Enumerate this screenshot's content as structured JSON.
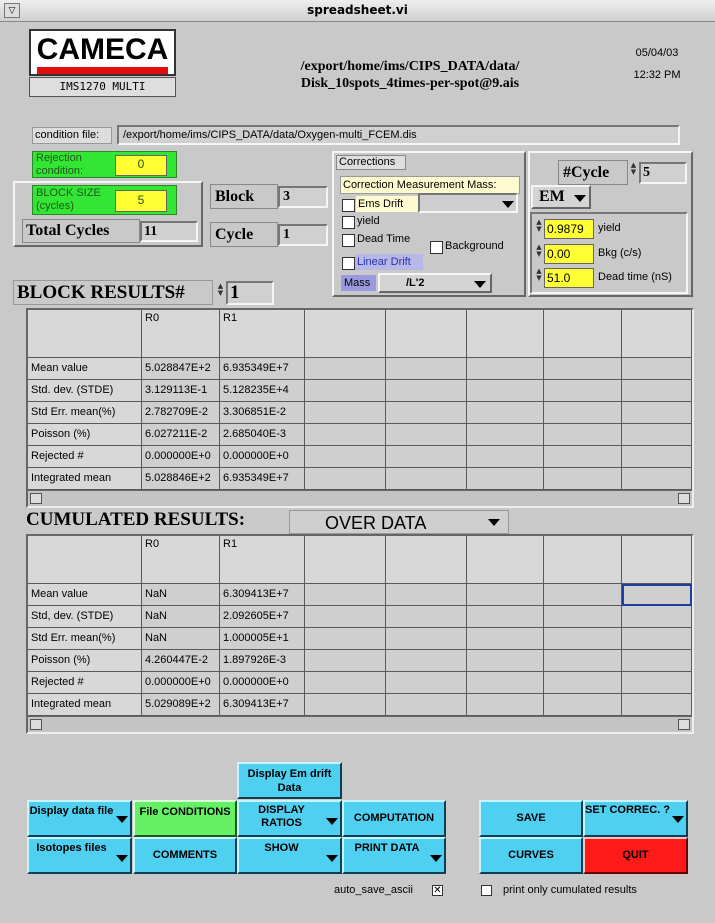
{
  "window": {
    "title": "spreadsheet.vi",
    "sys_menu_symbol": "▽"
  },
  "header": {
    "logo": "CAMECA",
    "instrument": "IMS1270 MULTI",
    "path_line1": "/export/home/ims/CIPS_DATA/data/",
    "path_line2": "Disk_10spots_4times-per-spot@9.ais",
    "date": "05/04/03",
    "time": "12:32 PM"
  },
  "condition_file": {
    "label": "condition file:",
    "value": "/export/home/ims/CIPS_DATA/data/Oxygen-multi_FCEM.dis"
  },
  "rejection": {
    "label": "Rejection condition:",
    "value": "0"
  },
  "block_size": {
    "label": "BLOCK SIZE (cycles)",
    "value": "5"
  },
  "total_cycles": {
    "label": "Total Cycles",
    "value": "11"
  },
  "block": {
    "label": "Block",
    "value": "3"
  },
  "cycle": {
    "label": "Cycle",
    "value": "1"
  },
  "corrections": {
    "tab": "Corrections",
    "measurement_mass": "Correction Measurement Mass:",
    "ems_drift": "Ems Drift",
    "yield": "yield",
    "dead_time": "Dead Time",
    "background": "Background",
    "linear_drift": "Linear Drift",
    "mass_label": "Mass",
    "mass_value": "/L'2"
  },
  "detector": {
    "ncycle_label": "#Cycle",
    "ncycle_value": "5",
    "detector_type": "EM",
    "params": [
      {
        "value": "0.9879",
        "label": "yield"
      },
      {
        "value": "0.00",
        "label": "Bkg (c/s)"
      },
      {
        "value": "51.0",
        "label": "Dead time (nS)"
      }
    ]
  },
  "block_results": {
    "title": "BLOCK RESULTS#",
    "number": "1",
    "columns": [
      "R0",
      "R1"
    ],
    "rows": [
      {
        "label": "Mean value",
        "values": [
          "5.028847E+2",
          "6.935349E+7"
        ]
      },
      {
        "label": "Std. dev. (STDE)",
        "values": [
          "3.129113E-1",
          "5.128235E+4"
        ]
      },
      {
        "label": "Std Err. mean(%)",
        "values": [
          "2.782709E-2",
          "3.306851E-2"
        ]
      },
      {
        "label": "Poisson (%)",
        "values": [
          "6.027211E-2",
          "2.685040E-3"
        ]
      },
      {
        "label": "Rejected #",
        "values": [
          "0.000000E+0",
          "0.000000E+0"
        ]
      },
      {
        "label": "Integrated mean",
        "values": [
          "5.028846E+2",
          "6.935349E+7"
        ]
      }
    ]
  },
  "cumulated_results": {
    "title": "CUMULATED RESULTS:",
    "mode": "OVER DATA",
    "columns": [
      "R0",
      "R1"
    ],
    "rows": [
      {
        "label": "Mean value",
        "values": [
          "NaN",
          "6.309413E+7"
        ]
      },
      {
        "label": "Std, dev. (STDE)",
        "values": [
          "NaN",
          "2.092605E+7"
        ]
      },
      {
        "label": "Std Err. mean(%)",
        "values": [
          "NaN",
          "1.000005E+1"
        ]
      },
      {
        "label": "Poisson (%)",
        "values": [
          "4.260447E-2",
          "1.897926E-3"
        ]
      },
      {
        "label": "Rejected #",
        "values": [
          "0.000000E+0",
          "0.000000E+0"
        ]
      },
      {
        "label": "Integrated mean",
        "values": [
          "5.029089E+2",
          "6.309413E+7"
        ]
      }
    ]
  },
  "buttons": {
    "display_em_drift": "Display Em drift Data",
    "display_data_file": "Display data file",
    "file_conditions": "File CONDITIONS",
    "display_ratios": "DISPLAY RATIOS",
    "computation": "COMPUTATION",
    "isotopes_files": "Isotopes files",
    "comments": "COMMENTS",
    "show": "SHOW",
    "print_data": "PRINT DATA",
    "save": "SAVE",
    "set_correc": "SET CORREC. ?",
    "curves": "CURVES",
    "quit": "QUIT"
  },
  "footer": {
    "auto_save": "auto_save_ascii",
    "print_only": "print only cumulated results"
  },
  "colors": {
    "button": "#4fd0f0",
    "green_button": "#66f066",
    "quit": "#ff1a1a",
    "indicator_green": "#33e633",
    "indicator_yellow": "#ffff33"
  }
}
